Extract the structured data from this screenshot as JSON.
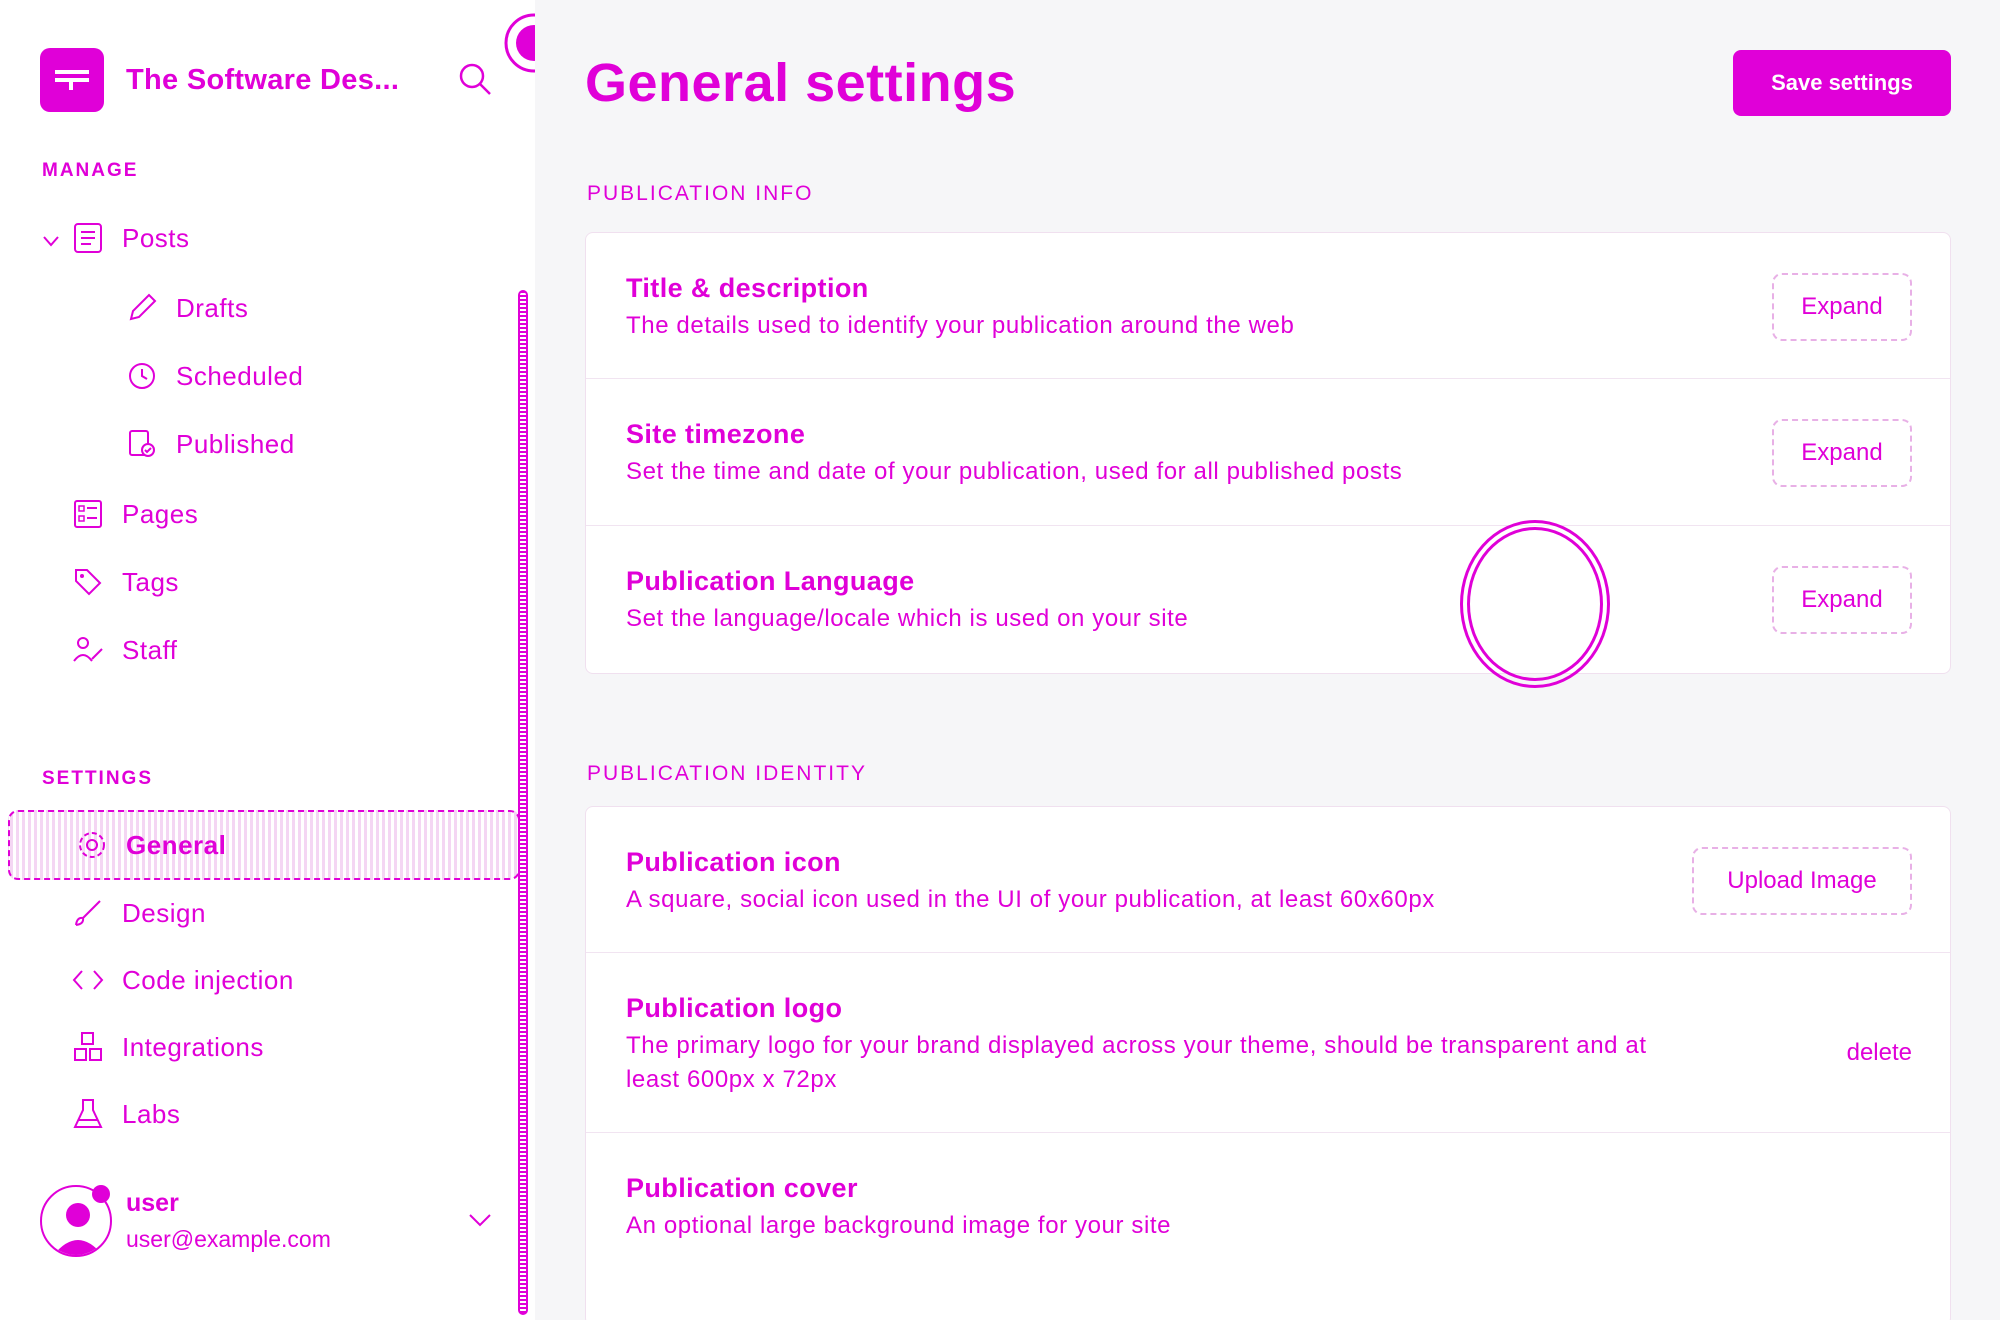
{
  "sidebar": {
    "brand_title": "The Software Des...",
    "manage_label": "MANAGE",
    "settings_label": "SETTINGS",
    "manage_items": [
      {
        "label": "Posts",
        "icon": "posts-icon"
      },
      {
        "label": "Drafts",
        "icon": "pencil-icon"
      },
      {
        "label": "Scheduled",
        "icon": "clock-icon"
      },
      {
        "label": "Published",
        "icon": "published-icon"
      },
      {
        "label": "Pages",
        "icon": "pages-icon"
      },
      {
        "label": "Tags",
        "icon": "tag-icon"
      },
      {
        "label": "Staff",
        "icon": "staff-icon"
      }
    ],
    "settings_items": [
      {
        "label": "General",
        "icon": "gear-icon"
      },
      {
        "label": "Design",
        "icon": "brush-icon"
      },
      {
        "label": "Code injection",
        "icon": "code-icon"
      },
      {
        "label": "Integrations",
        "icon": "integrations-icon"
      },
      {
        "label": "Labs",
        "icon": "flask-icon"
      }
    ],
    "user": {
      "name": "user",
      "email": "user@example.com"
    }
  },
  "main": {
    "title": "General settings",
    "save_label": "Save settings",
    "publication_info": {
      "label": "PUBLICATION INFO",
      "rows": [
        {
          "title": "Title & description",
          "desc": "The details used to identify your publication around the web",
          "action": "Expand"
        },
        {
          "title": "Site timezone",
          "desc": "Set the time and date of your publication, used for all published posts",
          "action": "Expand"
        },
        {
          "title": "Publication Language",
          "desc": "Set the language/locale which is used on your site",
          "action": "Expand"
        }
      ]
    },
    "publication_identity": {
      "label": "PUBLICATION IDENTITY",
      "rows": [
        {
          "title": "Publication icon",
          "desc": "A square, social icon used in the UI of your publication, at least 60x60px",
          "action": "Upload Image"
        },
        {
          "title": "Publication logo",
          "desc": "The primary logo for your brand displayed across your theme, should be transparent and at least 600px x 72px",
          "action": "delete"
        },
        {
          "title": "Publication cover",
          "desc": "An optional large background image for your site",
          "action": ""
        }
      ]
    }
  },
  "colors": {
    "accent": "#e000d8",
    "background": "#f6f6f8"
  }
}
